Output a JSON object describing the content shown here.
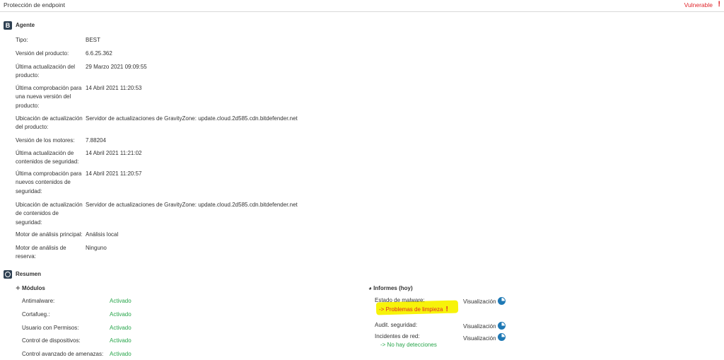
{
  "header": {
    "title": "Protección de endpoint",
    "status": "Vulnerable",
    "status_mark": "!"
  },
  "agent": {
    "icon_letter": "B",
    "title": "Agente",
    "rows": [
      {
        "label": "Tipo:",
        "value": "BEST"
      },
      {
        "label": "Versión del producto:",
        "value": "6.6.25.362"
      },
      {
        "label": "Última actualización del producto:",
        "value": "29 Marzo 2021 09:09:55"
      },
      {
        "label": "Última comprobación para una nueva versión del producto:",
        "value": "14 Abril 2021 11:20:53"
      },
      {
        "label": "Ubicación de actualización del producto:",
        "value": "Servidor de actualizaciones de GravityZone: update.cloud.2d585.cdn.bitdefender.net"
      },
      {
        "label": "Versión de los motores:",
        "value": "7.88204"
      },
      {
        "label": "Última actualización de contenidos de seguridad:",
        "value": "14 Abril 2021 11:21:02"
      },
      {
        "label": "Última comprobación para nuevos contenidos de seguridad:",
        "value": "14 Abril 2021 11:20:57"
      },
      {
        "label": "Ubicación de actualización de contenidos de seguridad:",
        "value": "Servidor de actualizaciones de GravityZone: update.cloud.2d585.cdn.bitdefender.net"
      },
      {
        "label": "Motor de análisis principal:",
        "value": "Análisis local"
      },
      {
        "label": "Motor de análisis de reserva:",
        "value": "Ninguno"
      }
    ]
  },
  "summary": {
    "title": "Resumen",
    "modules": {
      "title": "Módulos",
      "items": [
        {
          "label": "Antimalware:",
          "value": "Activado"
        },
        {
          "label": "Cortafueg.:",
          "value": "Activado"
        },
        {
          "label": "Usuario con Permisos:",
          "value": "Activado"
        },
        {
          "label": "Control de dispositivos:",
          "value": "Activado"
        },
        {
          "label": "Control avanzado de amenazas:",
          "value": "Activado"
        }
      ]
    },
    "reports": {
      "title": "Informes (hoy)",
      "items": [
        {
          "label": "Estado de malware:",
          "link": "Visualización",
          "detail": "-> Problemas de limpieza",
          "detail_mark": "!"
        },
        {
          "label": "Audit. seguridad:",
          "link": "Visualización"
        },
        {
          "label": "Incidentes de red:",
          "link": "Visualización",
          "detail": "-> No hay detecciones"
        }
      ]
    }
  },
  "colors": {
    "accent": "#2e4052",
    "ok": "#27a54a",
    "alert": "#e0242a",
    "highlight": "#f7f30a",
    "pie": "#1f79b5"
  }
}
